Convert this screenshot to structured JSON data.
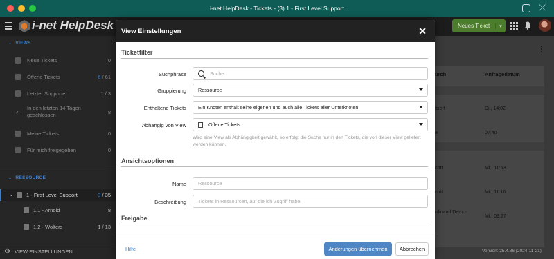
{
  "window": {
    "title": "i-net HelpDesk - Tickets - (3) 1 - First Level Support",
    "traffic_colors": [
      "#ff5f57",
      "#febc2e",
      "#28c840"
    ]
  },
  "app": {
    "logo_text": "i-net HelpDesk",
    "new_ticket_label": "Neues Ticket",
    "new_ticket_caret": "▾"
  },
  "sidebar": {
    "views_header": "VIEWS",
    "views": [
      {
        "label": "Neue Tickets",
        "count": "0"
      },
      {
        "label": "Offene Tickets",
        "count_a": "6",
        "count_b": "/ 61"
      },
      {
        "label": "Letzter Supporter",
        "count": "1 / 3"
      },
      {
        "label": "In den letzten 14 Tagen geschlossen",
        "count": "8"
      },
      {
        "label": "Meine Tickets",
        "count": "0"
      },
      {
        "label": "Für mich freigegeben",
        "count": "0"
      }
    ],
    "resource_header": "RESSOURCE",
    "resources": [
      {
        "label": "1 - First Level Support",
        "count_a": "3",
        "count_b": "/ 35"
      },
      {
        "label": "1.1 - Arnold",
        "count": "8"
      },
      {
        "label": "1.2 - Wolters",
        "count": "1 / 13"
      }
    ],
    "footer_label": "VIEW EINSTELLUNGEN"
  },
  "main": {
    "col_by": "urch",
    "col_date": "Anfragedatum",
    "rows": [
      {
        "by": "isiert",
        "date": "Di., 14:02"
      },
      {
        "by": "e",
        "date": "07:40"
      },
      {
        "by": "cott",
        "date": "Mi., 11:53"
      },
      {
        "by": "cott",
        "date": "Mi., 11:16"
      },
      {
        "by": "rdinand Demo-",
        "date": "Mi., 09:27"
      }
    ],
    "version": "Version: 25.4.86 (2024-11-21)"
  },
  "modal": {
    "title": "View Einstellungen",
    "close": "✕",
    "sec_filter": "Ticketfilter",
    "search_label": "Suchphrase",
    "search_placeholder": "Suche",
    "group_label": "Gruppierung",
    "group_value": "Ressource",
    "contained_label": "Enthaltene Tickets",
    "contained_value": "Ein Knoten enthält seine eigenen und auch alle Tickets aller Unterknoten",
    "depends_label": "Abhängig von View",
    "depends_value": "Offene Tickets",
    "depends_hint": "Wird eine View als Abhängigkeit gewählt, so erfolgt die Suche nur in den Tickets, die von dieser View geliefert werden können.",
    "sec_view": "Ansichtsoptionen",
    "name_label": "Name",
    "name_placeholder": "Ressource",
    "desc_label": "Beschreibung",
    "desc_placeholder": "Tickets in Ressourcen, auf die ich Zugriff habe",
    "sec_share": "Freigabe",
    "help": "Hilfe",
    "apply": "Änderungen übernehmen",
    "cancel": "Abbrechen"
  }
}
